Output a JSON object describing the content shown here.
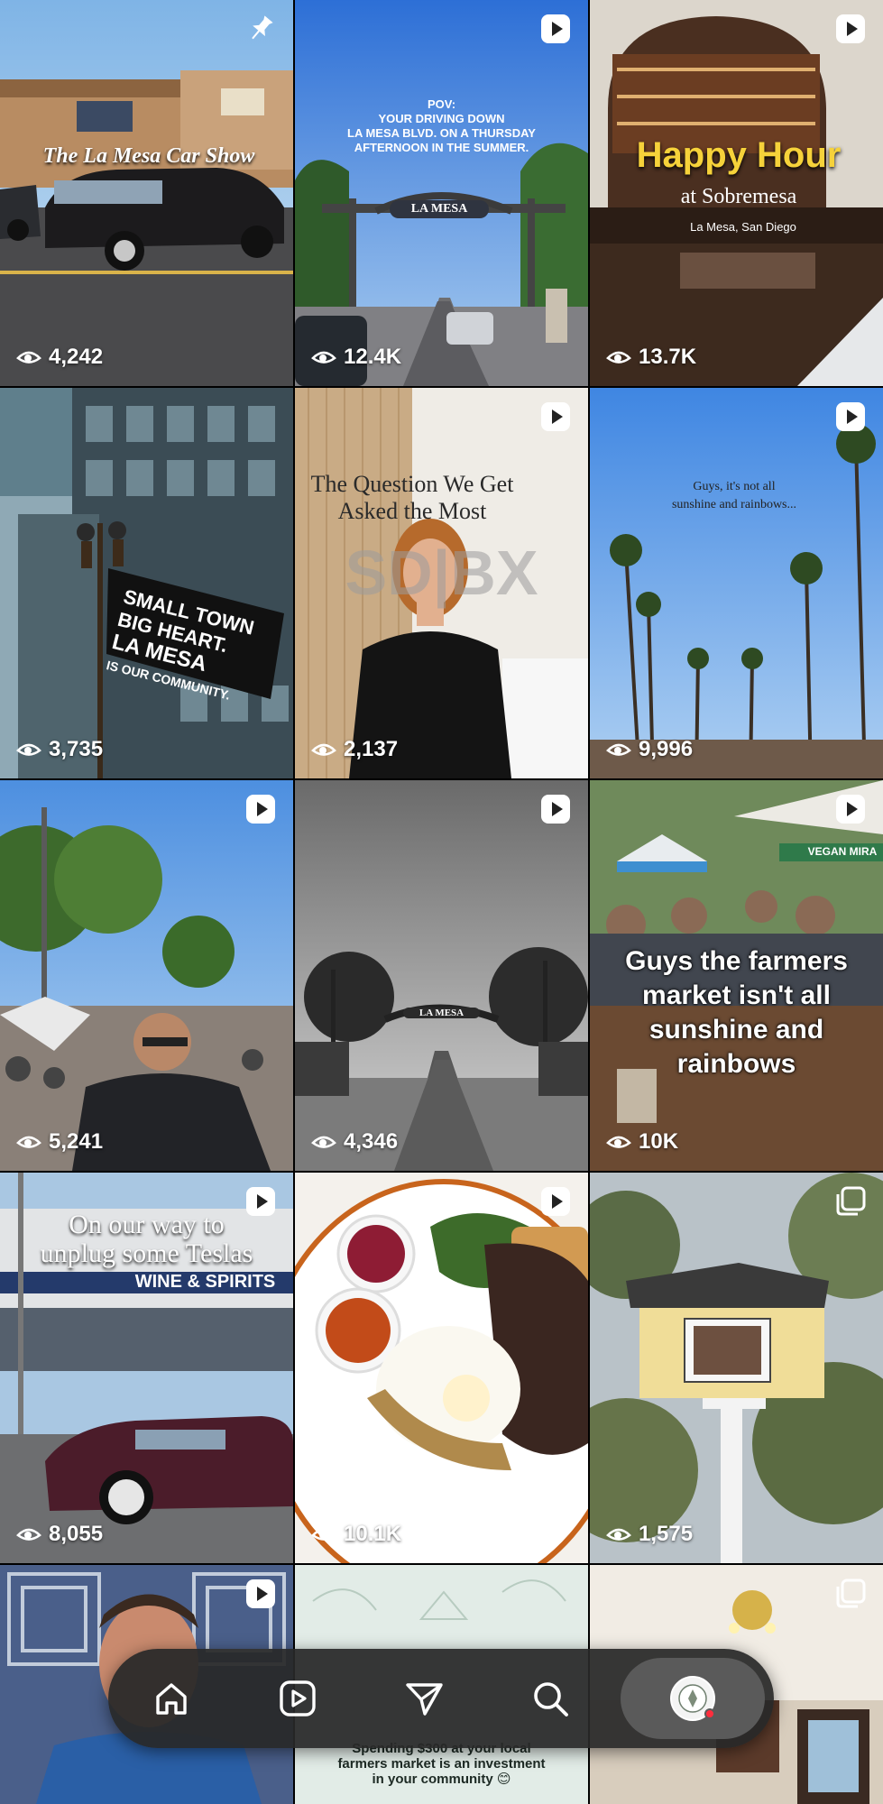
{
  "grid": {
    "tiles": [
      {
        "views": "4,242",
        "badge": "pin-icon",
        "caption": "The La Mesa Car Show"
      },
      {
        "views": "12.4K",
        "badge": "reel-icon",
        "caption_lines": [
          "POV:",
          "YOUR DRIVING DOWN",
          "LA MESA BLVD. ON A THURSDAY",
          "AFTERNOON IN THE SUMMER."
        ],
        "sign": "LA MESA"
      },
      {
        "views": "13.7K",
        "badge": "reel-icon",
        "title": "Happy Hour",
        "subtitle": "at Sobremesa",
        "location": "La Mesa, San Diego"
      },
      {
        "views": "3,735",
        "badge": "",
        "flag_lines": [
          "SMALL TOWN",
          "BIG HEART.",
          "LA MESA",
          "IS OUR COMMUNITY."
        ]
      },
      {
        "views": "2,137",
        "badge": "reel-icon",
        "caption_lines": [
          "The Question We Get",
          "Asked the Most"
        ],
        "wall": "SD|BX"
      },
      {
        "views": "9,996",
        "badge": "reel-icon",
        "caption_lines": [
          "Guys, it's not all",
          "sunshine and rainbows..."
        ]
      },
      {
        "views": "5,241",
        "badge": "reel-icon"
      },
      {
        "views": "4,346",
        "badge": "reel-icon",
        "sign": "LA MESA"
      },
      {
        "views": "10K",
        "badge": "reel-icon",
        "caption_lines": [
          "Guys the farmers",
          "market isn't all",
          "sunshine and",
          "rainbows"
        ],
        "awning": "VEGAN MIRA"
      },
      {
        "views": "8,055",
        "badge": "reel-icon",
        "caption_lines": [
          "On our way to",
          "unplug some Teslas"
        ],
        "storefront": "WINE & SPIRITS"
      },
      {
        "views": "10.1K",
        "badge": "reel-icon"
      },
      {
        "views": "1,575",
        "badge": "carousel-icon"
      },
      {
        "views": "",
        "badge": "reel-icon"
      },
      {
        "views": "",
        "badge": "",
        "caption_lines": [
          "Spending $300 at your local",
          "farmers market is an investment",
          "in your community 😊"
        ]
      },
      {
        "views": "",
        "badge": "carousel-icon"
      }
    ]
  },
  "nav": {
    "items": [
      "home-icon",
      "reels-icon",
      "send-icon",
      "search-icon",
      "profile-avatar"
    ]
  }
}
